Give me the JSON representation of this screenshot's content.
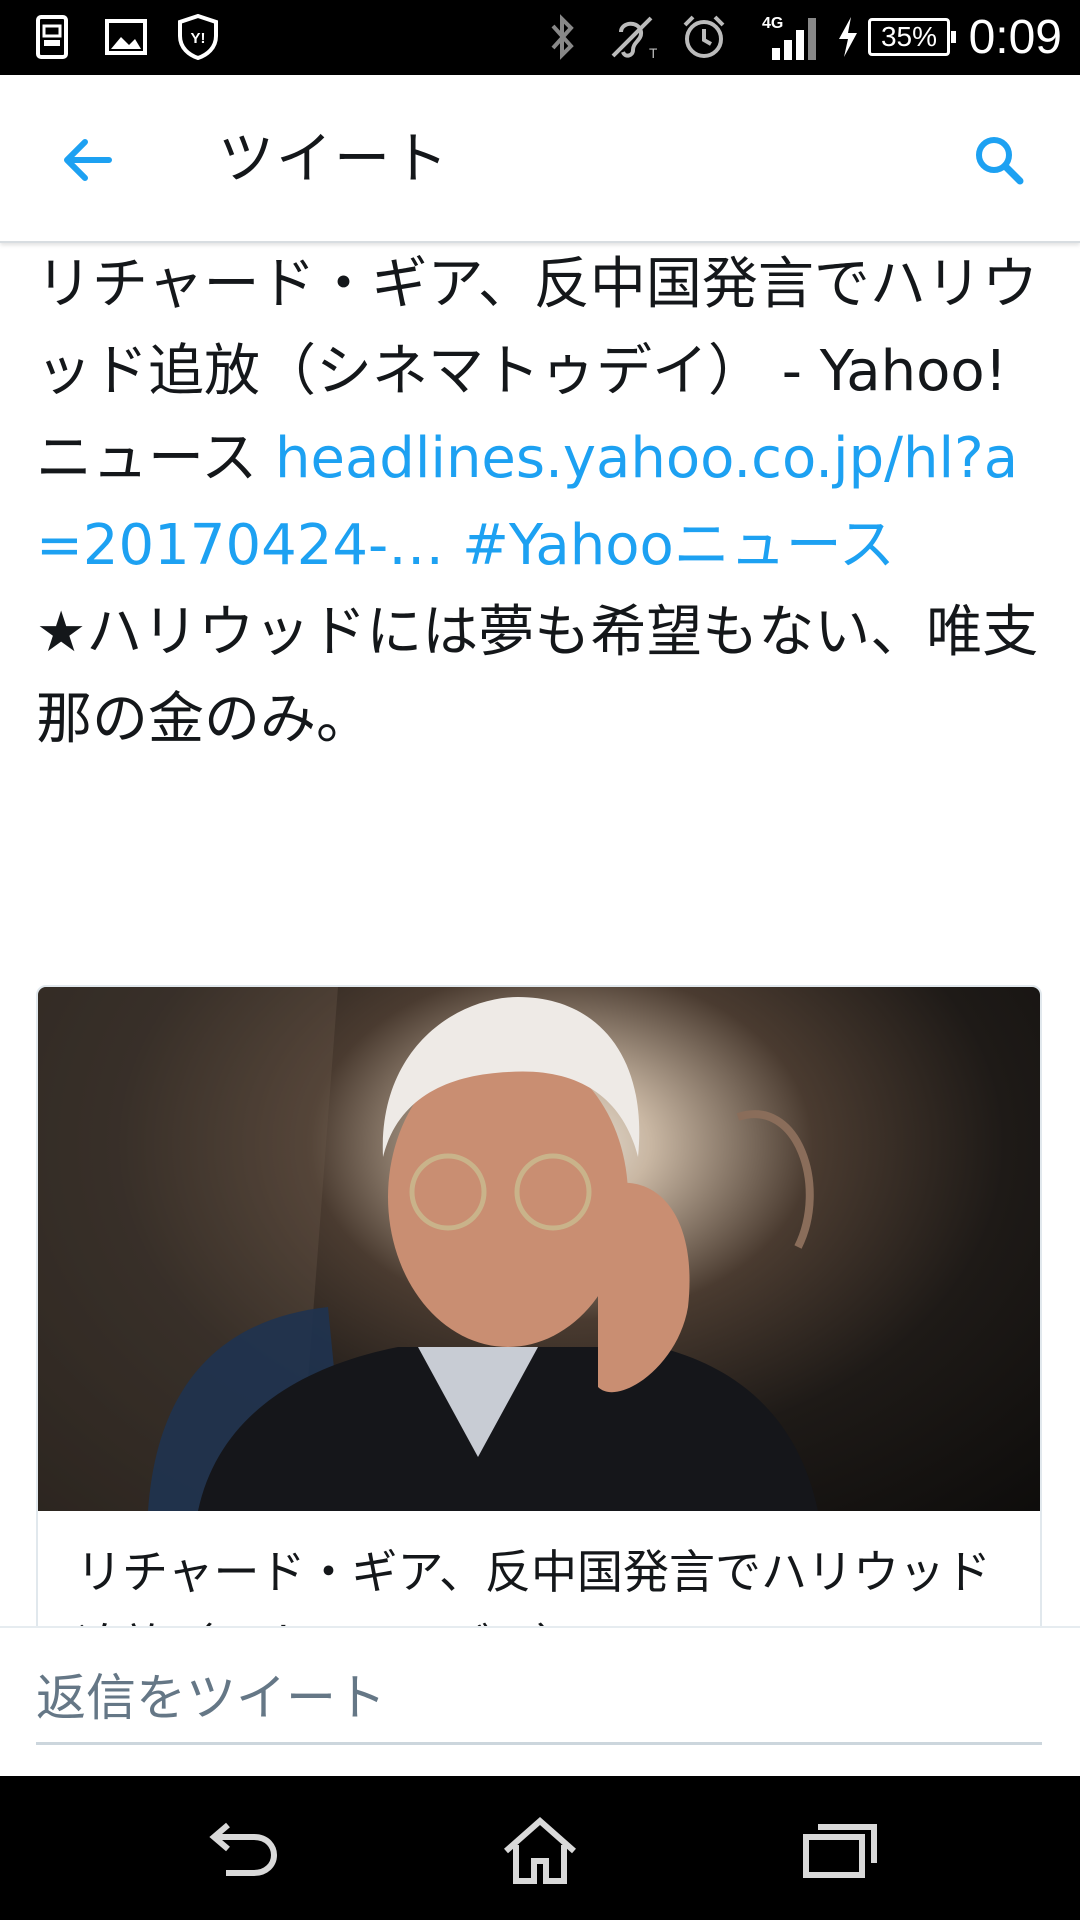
{
  "status_bar": {
    "time": "0:09",
    "battery": "35%",
    "network": "4G",
    "icons": [
      "screen-mirror-icon",
      "image-icon",
      "yahoo-shield-icon",
      "bluetooth-icon",
      "hearing-icon",
      "alarm-icon",
      "signal-icon",
      "charging-icon"
    ]
  },
  "app_bar": {
    "title": "ツイート",
    "back_icon": "back-arrow-icon",
    "search_icon": "search-icon"
  },
  "tweet": {
    "text_main": "リチャード・ギア、反中国発言でハリウッド追放（シネマトゥデイ） - Yahoo!ニュース ",
    "link_url": "headlines.yahoo.co.jp/hl?a=20170424-…",
    "hashtag": "#Yahooニュース",
    "comment": "★ハリウッドには夢も希望もない、唯支那の金のみ。"
  },
  "card": {
    "title": "リチャード・ギア、反中国発言でハリウッド追放（シネマトゥデイ）"
  },
  "reply": {
    "placeholder": "返信をツイート"
  },
  "nav_bar": {
    "icons": [
      "back-icon",
      "home-icon",
      "recent-apps-icon"
    ]
  },
  "colors": {
    "accent": "#1da1f2",
    "text": "#14171a",
    "muted": "#657786"
  }
}
